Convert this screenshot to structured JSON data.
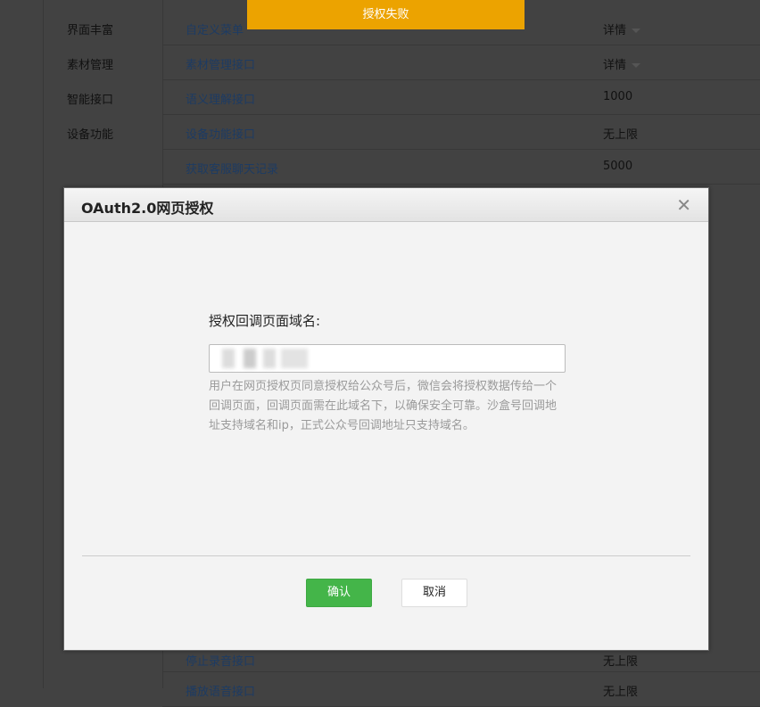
{
  "table": {
    "rows": [
      {
        "category": "界面丰富",
        "name": "自定义菜单",
        "value": "详情",
        "dropdown": true
      },
      {
        "category": "素材管理",
        "name": "素材管理接口",
        "value": "详情",
        "dropdown": true
      },
      {
        "category": "智能接口",
        "name": "语义理解接口",
        "value": "1000"
      },
      {
        "category": "设备功能",
        "name": "设备功能接口",
        "value": "无上限"
      },
      {
        "category": "",
        "name": "获取客服聊天记录",
        "value": "5000"
      }
    ],
    "bottom_rows": [
      {
        "name": "停止录音接口",
        "value": "无上限"
      },
      {
        "name": "播放语音接口",
        "value": "无上限"
      }
    ]
  },
  "toast": {
    "text": "授权失败",
    "color": "#eca300"
  },
  "dialog": {
    "title": "OAuth2.0网页授权",
    "field_label": "授权回调页面域名:",
    "field_value": "",
    "tips": "用户在网页授权页同意授权给公众号后，微信会将授权数据传给一个回调页面，回调页面需在此域名下，以确保安全可靠。沙盒号回调地址支持域名和ip，正式公众号回调地址只支持域名。",
    "confirm_label": "确认",
    "cancel_label": "取消",
    "confirm_color": "#44b549"
  }
}
